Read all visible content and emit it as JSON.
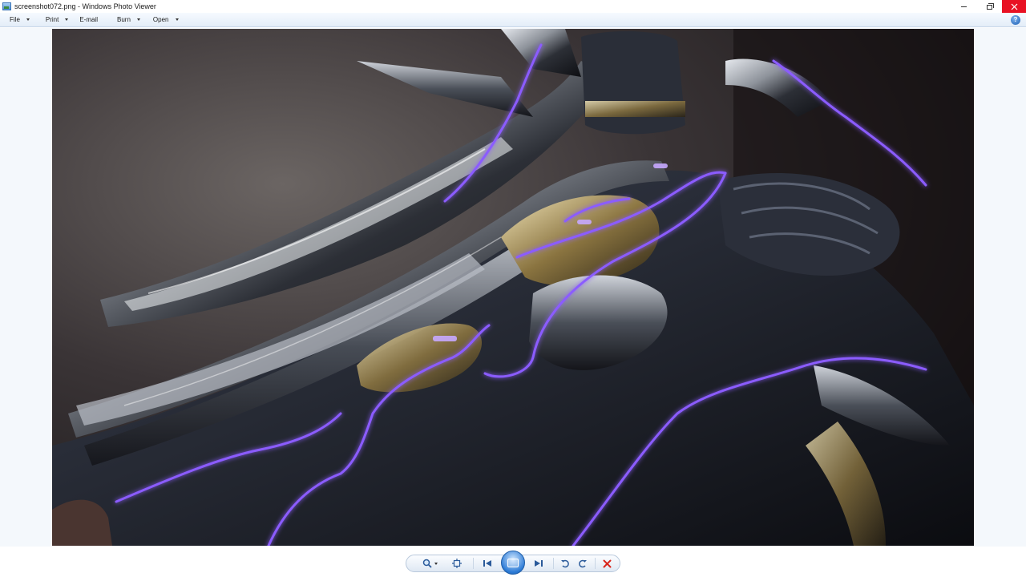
{
  "window": {
    "title": "screenshot072.png - Windows Photo Viewer"
  },
  "menu": {
    "items": [
      {
        "label": "File",
        "has_dropdown": true
      },
      {
        "label": "Print",
        "has_dropdown": true
      },
      {
        "label": "E-mail",
        "has_dropdown": false
      },
      {
        "label": "Burn",
        "has_dropdown": true
      },
      {
        "label": "Open",
        "has_dropdown": true
      }
    ],
    "help_label": "?"
  },
  "colors": {
    "titlebar_bg": "#ffffff",
    "close_red": "#e81123",
    "menubar_bg": "#e3edf8",
    "viewer_bg": "#f4f8fc",
    "accent_blue": "#2c7bd6",
    "delete_red": "#d9261c",
    "image_glow": "#8a5cff"
  },
  "photo": {
    "description_icon": "image-content",
    "subject": "sci-fi weapon render"
  },
  "toolbar": {
    "buttons": [
      {
        "name": "zoom-button",
        "icon": "magnifier-icon"
      },
      {
        "name": "actual-size-button",
        "icon": "fit-window-icon"
      },
      {
        "name": "previous-button",
        "icon": "previous-icon"
      },
      {
        "name": "slideshow-button",
        "icon": "slideshow-icon"
      },
      {
        "name": "next-button",
        "icon": "next-icon"
      },
      {
        "name": "rotate-ccw-button",
        "icon": "rotate-counterclockwise-icon"
      },
      {
        "name": "rotate-cw-button",
        "icon": "rotate-clockwise-icon"
      },
      {
        "name": "delete-button",
        "icon": "delete-x-icon"
      }
    ]
  }
}
